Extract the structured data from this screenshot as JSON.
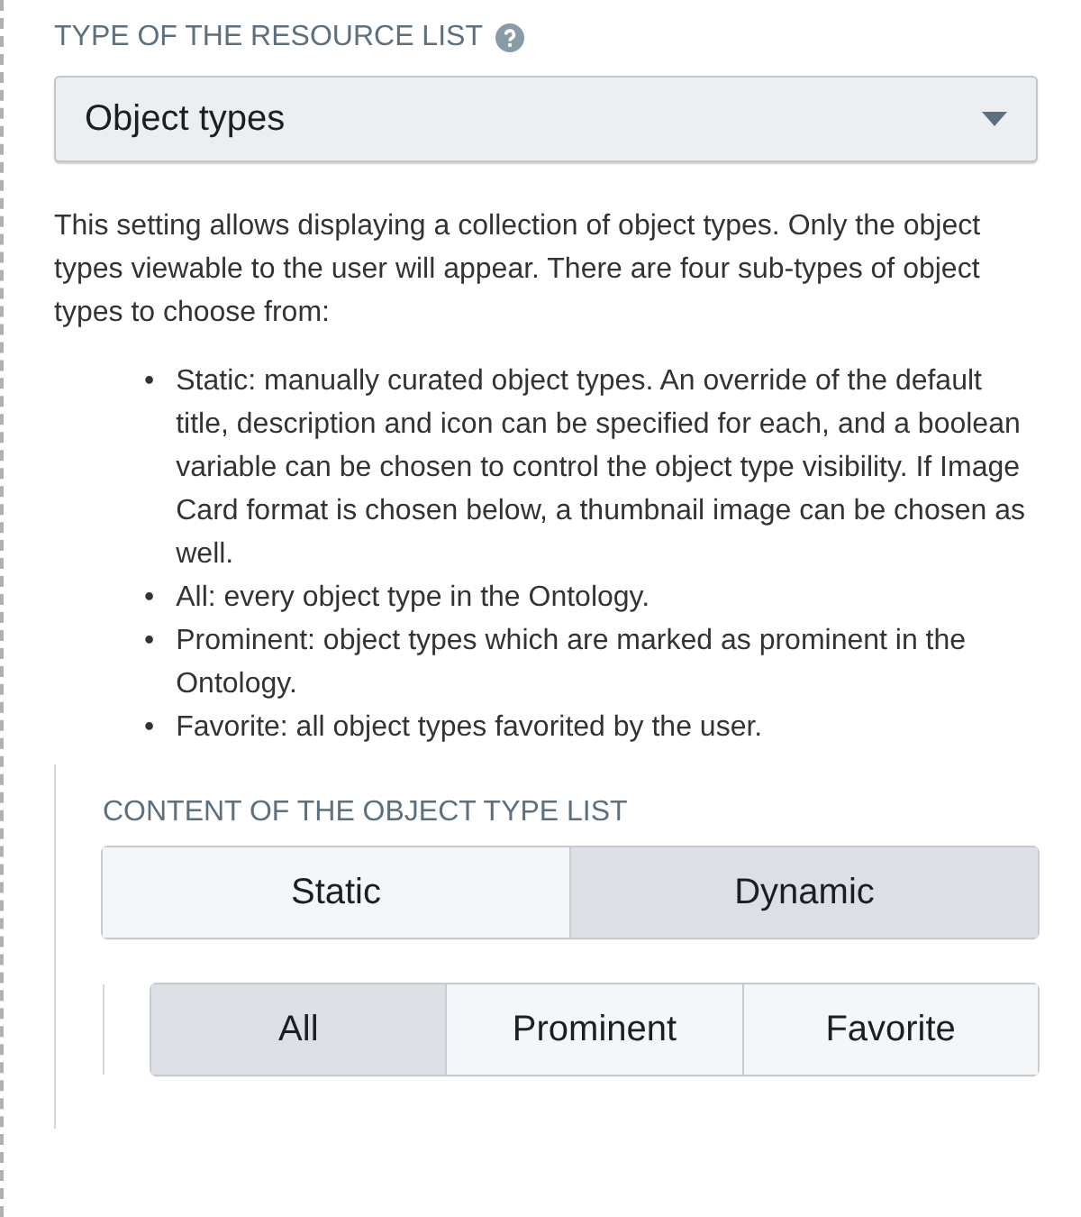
{
  "resource_type": {
    "label": "TYPE OF THE RESOURCE LIST",
    "select": {
      "value": "Object types"
    }
  },
  "description": "This setting allows displaying a collection of object types. Only the object types viewable to the user will appear. There are four sub-types of object types to choose from:",
  "subtypes": [
    {
      "marker": "•",
      "text": "Static: manually curated object types. An override of the default title, description and icon can be specified for each, and a boolean variable can be chosen to control the object type visibility. If Image Card format is chosen below, a thumbnail image can be chosen as well."
    },
    {
      "marker": "•",
      "text": "All: every object type in the Ontology."
    },
    {
      "marker": "•",
      "text": "Prominent: object types which are marked as prominent in the Ontology."
    },
    {
      "marker": "•",
      "text": "Favorite: all object types favorited by the user."
    }
  ],
  "content": {
    "label": "CONTENT OF THE OBJECT TYPE LIST",
    "modes": [
      {
        "label": "Static",
        "selected": false
      },
      {
        "label": "Dynamic",
        "selected": true
      }
    ],
    "dynamic_options": [
      {
        "label": "All",
        "selected": true
      },
      {
        "label": "Prominent",
        "selected": false
      },
      {
        "label": "Favorite",
        "selected": false
      }
    ]
  }
}
